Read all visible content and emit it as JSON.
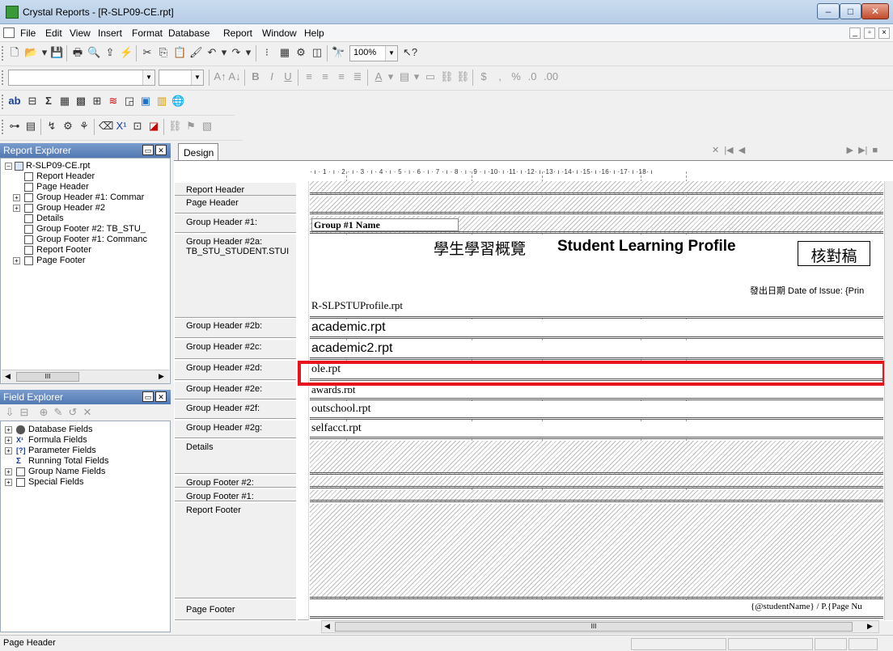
{
  "window": {
    "title": "Crystal Reports - [R-SLP09-CE.rpt]",
    "min": "–",
    "max": "□",
    "close": "✕"
  },
  "menu": [
    "File",
    "Edit",
    "View",
    "Insert",
    "Format",
    "Database",
    "Report",
    "Window",
    "Help"
  ],
  "toolbar": {
    "zoom": "100%"
  },
  "report_explorer": {
    "title": "Report Explorer",
    "items": [
      {
        "label": "R-SLP09-CE.rpt",
        "exp": "–"
      },
      {
        "label": "Report Header"
      },
      {
        "label": "Page Header"
      },
      {
        "label": "Group Header #1: Commar",
        "exp": "+"
      },
      {
        "label": "Group Header #2",
        "exp": "+"
      },
      {
        "label": "Details"
      },
      {
        "label": "Group Footer #2: TB_STU_"
      },
      {
        "label": "Group Footer #1: Commanc"
      },
      {
        "label": "Report Footer"
      },
      {
        "label": "Page Footer",
        "exp": "+"
      }
    ],
    "scroll_label": "III"
  },
  "field_explorer": {
    "title": "Field Explorer",
    "items": [
      {
        "label": "Database Fields",
        "exp": "+"
      },
      {
        "label": "Formula Fields",
        "exp": "+"
      },
      {
        "label": "Parameter Fields",
        "exp": "+"
      },
      {
        "label": "Running Total Fields"
      },
      {
        "label": "Group Name Fields",
        "exp": "+"
      },
      {
        "label": "Special Fields",
        "exp": "+"
      }
    ]
  },
  "design": {
    "tab": "Design",
    "ruler": "· ı · 1 · ı · 2 · ı · 3 · ı · 4 · ı · 5 · ı · 6 · ı · 7 · ı · 8 · ı · 9 · ı ·10· ı ·11· ı ·12· ı ·13· ı ·14· ı ·15· ı ·16· ı ·17· ı ·18· ı",
    "nav": "✕  |◀  ◀                                         ▶  ▶|  ■",
    "sections": {
      "report_header": "Report Header",
      "page_header": "Page Header",
      "gh1": "Group Header #1:",
      "gh2a": "Group Header #2a:",
      "gh2a_sub": "TB_STU_STUDENT.STUI",
      "gh2b": "Group Header #2b:",
      "gh2c": "Group Header #2c:",
      "gh2d": "Group Header #2d:",
      "gh2e": "Group Header #2e:",
      "gh2f": "Group Header #2f:",
      "gh2g": "Group Header #2g:",
      "details": "Details",
      "gf2": "Group Footer #2:",
      "gf1": "Group Footer #1:",
      "report_footer": "Report Footer",
      "page_footer": "Page Footer"
    },
    "fields": {
      "group1_name": "Group #1 Name",
      "title_zh": "學生學習概覽",
      "title_en": "Student Learning Profile",
      "stamp": "核對稿",
      "date_issue": "發出日期 Date of Issue: {Prin",
      "subreport_main": "R-SLPSTUProfile.rpt",
      "sub_academic": "academic.rpt",
      "sub_academic2": "academic2.rpt",
      "sub_ole": "ole.rpt",
      "sub_awards": "awards.rpt",
      "sub_outschool": "outschool.rpt",
      "sub_selfacct": "selfacct.rpt",
      "footer_field": "{@studentName} / P.{Page Nu"
    },
    "hscroll_label": "III"
  },
  "status": {
    "text": "Page Header"
  },
  "colors": {
    "highlight": "#e8141c"
  }
}
